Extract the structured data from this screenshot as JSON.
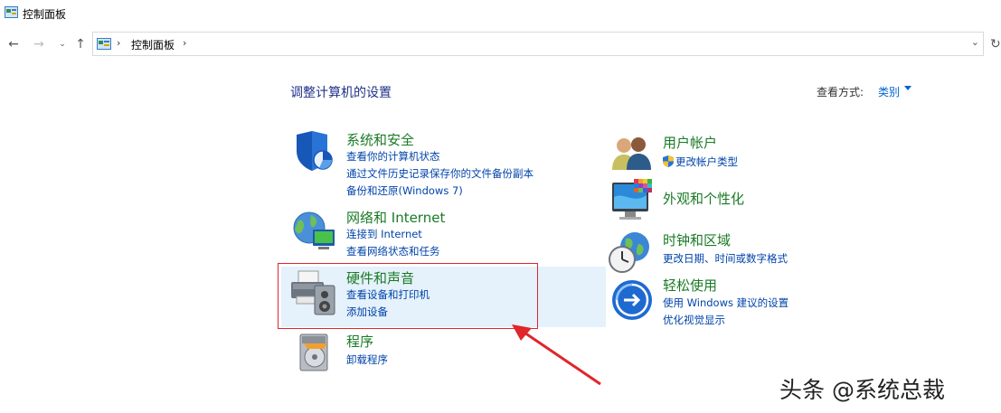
{
  "window": {
    "title": "控制面板"
  },
  "nav": {
    "back_icon": "back-arrow",
    "forward_icon": "forward-arrow",
    "recent_icon": "chevron-down",
    "up_icon": "up-arrow",
    "breadcrumb": "控制面板",
    "refresh_icon": "refresh"
  },
  "page": {
    "heading": "调整计算机的设置",
    "view_by_label": "查看方式:",
    "view_by_value": "类别"
  },
  "categories_left": [
    {
      "title": "系统和安全",
      "icon": "security-shield",
      "links": [
        "查看你的计算机状态",
        "通过文件历史记录保存你的文件备份副本",
        "备份和还原(Windows 7)"
      ]
    },
    {
      "title": "网络和 Internet",
      "icon": "network-globe",
      "links": [
        "连接到 Internet",
        "查看网络状态和任务"
      ]
    },
    {
      "title": "硬件和声音",
      "icon": "printer-speaker",
      "links": [
        "查看设备和打印机",
        "添加设备"
      ]
    },
    {
      "title": "程序",
      "icon": "programs-disc",
      "links": [
        "卸载程序"
      ]
    }
  ],
  "categories_right": [
    {
      "title": "用户帐户",
      "icon": "users",
      "links": [
        "更改帐户类型"
      ]
    },
    {
      "title": "外观和个性化",
      "icon": "monitor",
      "links": []
    },
    {
      "title": "时钟和区域",
      "icon": "clock-globe",
      "links": [
        "更改日期、时间或数字格式"
      ]
    },
    {
      "title": "轻松使用",
      "icon": "accessibility",
      "links": [
        "使用 Windows 建议的设置",
        "优化视觉显示"
      ]
    }
  ],
  "annotation": {
    "highlight_color": "#e0262b"
  },
  "watermark": "头条 @系统总裁",
  "colors": {
    "category_title": "#1a7a26",
    "link": "#0044aa",
    "heading": "#1e3287"
  }
}
